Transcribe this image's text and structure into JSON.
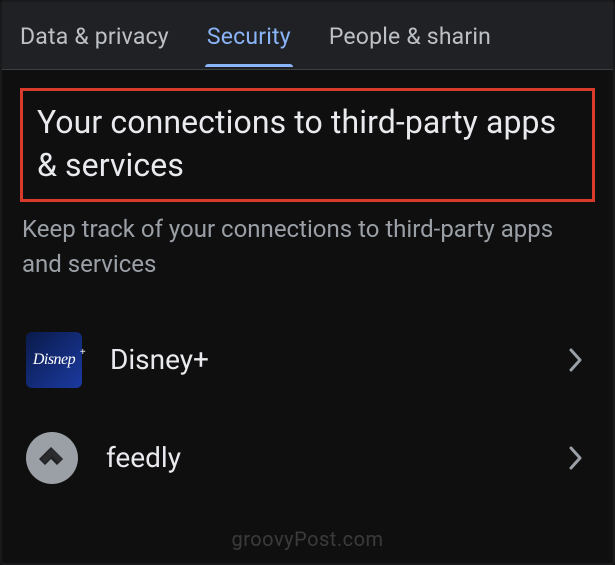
{
  "tabs": [
    {
      "label": "Data & privacy",
      "active": false
    },
    {
      "label": "Security",
      "active": true
    },
    {
      "label": "People & sharin",
      "active": false
    }
  ],
  "section": {
    "title": "Your connections to third-party apps & services",
    "description": "Keep track of your connections to third-party apps and services"
  },
  "apps": [
    {
      "name": "Disney+",
      "icon": "disney-plus-icon"
    },
    {
      "name": "feedly",
      "icon": "feedly-icon"
    }
  ],
  "watermark": "groovyPost.com",
  "highlight_color": "#d83a2b",
  "accent_color": "#8ab4f8"
}
